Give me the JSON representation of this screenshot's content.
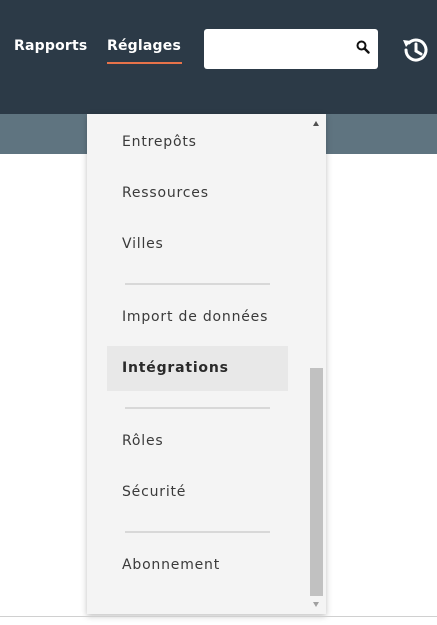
{
  "header": {
    "nav": [
      {
        "label": "Rapports"
      },
      {
        "label": "Réglages"
      }
    ],
    "accent_color": "#e8734a",
    "background": "#2c3a47",
    "search": {
      "value": "",
      "icon": "search-icon"
    },
    "history_icon": "history-icon"
  },
  "dropdown": {
    "items": [
      {
        "label": "Entrepôts"
      },
      {
        "label": "Ressources"
      },
      {
        "label": "Villes"
      },
      {
        "label": "Import de données"
      },
      {
        "label": "Intégrations",
        "active": true
      },
      {
        "label": "Rôles"
      },
      {
        "label": "Sécurité"
      },
      {
        "label": "Abonnement"
      }
    ]
  }
}
